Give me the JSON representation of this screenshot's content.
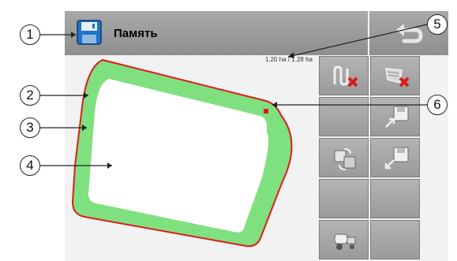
{
  "header": {
    "title": "Память",
    "save_icon": "floppy-disk-icon"
  },
  "back_button": {
    "icon": "return-arrow-icon"
  },
  "map": {
    "area_text": "1.20 ha / 1.28 ha"
  },
  "buttons": [
    {
      "name": "delete-tracks-button",
      "icon": "tracks-delete-icon"
    },
    {
      "name": "delete-field-boundary-button",
      "icon": "boundary-delete-icon"
    },
    {
      "name": "empty-button-1",
      "icon": ""
    },
    {
      "name": "save-from-button",
      "icon": "save-export-icon"
    },
    {
      "name": "exchange-button",
      "icon": "exchange-icon"
    },
    {
      "name": "load-into-button",
      "icon": "save-import-icon"
    },
    {
      "name": "empty-button-2",
      "icon": ""
    },
    {
      "name": "empty-button-3",
      "icon": ""
    },
    {
      "name": "machine-button",
      "icon": "tractor-sprayer-icon"
    },
    {
      "name": "empty-button-4",
      "icon": ""
    }
  ],
  "callouts": [
    "1",
    "2",
    "3",
    "4",
    "5",
    "6"
  ],
  "colors": {
    "header": "#9c9c9c",
    "field_headland": "#7fe07f",
    "field_boundary": "#e21a1a",
    "field_inner": "#ffffff",
    "button_face": "#a8a8a8"
  }
}
